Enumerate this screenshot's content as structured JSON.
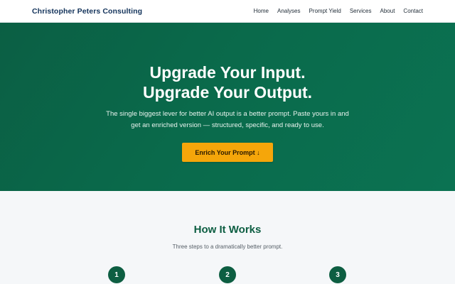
{
  "nav": {
    "brand": "Christopher Peters Consulting",
    "links": [
      "Home",
      "Analyses",
      "Prompt Yield",
      "Services",
      "About",
      "Contact"
    ]
  },
  "hero": {
    "title_line1": "Upgrade Your Input.",
    "title_line2": "Upgrade Your Output.",
    "subtitle_line1": "The single biggest lever for better AI output is a better prompt. Paste yours in and",
    "subtitle_line2": "get an enriched version — structured, specific, and ready to use.",
    "cta_label": "Enrich Your Prompt ↓"
  },
  "how_it_works": {
    "title": "How It Works",
    "subtitle": "Three steps to a dramatically better prompt.",
    "steps": [
      "1",
      "2",
      "3"
    ]
  },
  "colors": {
    "hero_green": "#0a6a4b",
    "accent_orange": "#f5a60a",
    "brand_navy": "#12325a",
    "section_green": "#0d5e42"
  }
}
